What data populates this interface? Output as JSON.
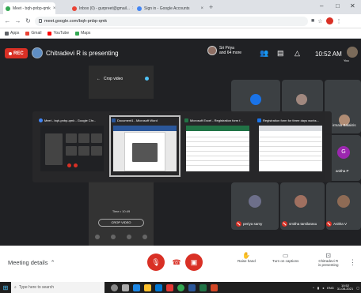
{
  "browser": {
    "tabs": [
      {
        "title": "Meet - bqh-pnbp-qmk",
        "favicon_color": "#34a853",
        "active": true
      },
      {
        "title": "Inbox (0) - gurpreet@gmail...",
        "favicon_color": "#ea4335",
        "active": false
      },
      {
        "title": "Sign in - Google Accounts",
        "favicon_color": "#4285f4",
        "active": false
      }
    ],
    "new_tab": "+",
    "window_controls": {
      "minimize": "–",
      "maximize": "□",
      "close": "✕"
    },
    "url": "meet.google.com/bqh-pnbp-qmk",
    "bookmarks": [
      {
        "label": "Apps",
        "color": "#5f6368"
      },
      {
        "label": "Gmail",
        "color": "#ea4335"
      },
      {
        "label": "YouTube",
        "color": "#ff0000"
      },
      {
        "label": "Maps",
        "color": "#34a853"
      }
    ]
  },
  "meet": {
    "rec_label": "REC",
    "presenter_status": "Chitradevi R is presenting",
    "participants_pill": {
      "line1": "Sri Priya",
      "line2": "and 64 more"
    },
    "clock": "10:52 AM",
    "you_label": "You",
    "phone_panel": {
      "menu_item": "Crop video",
      "time": "Time • 10:49",
      "crop_button": "CROP VIDEO"
    },
    "participants": [
      {
        "name": "periya samy",
        "avatar_color": "#6d6f8a"
      },
      {
        "name": "smitha tamilarasu",
        "avatar_color": "#a07060"
      },
      {
        "name": "Anitha V",
        "avatar_color": "#8e6b55"
      }
    ],
    "side_names": [
      {
        "name": "irmala Balakris",
        "avatar_color": "#b08c74"
      },
      {
        "name": "anitha P",
        "avatar_color": "#9c27b0",
        "initial": "G"
      }
    ]
  },
  "switcher": {
    "windows": [
      {
        "title": "Meet - bqh-pnbp-qmk - Google Chr...",
        "icon_color": "#4285f4",
        "selected": false
      },
      {
        "title": "Document1 - Microsoft Word",
        "icon_color": "#2b579a",
        "selected": true
      },
      {
        "title": "Microsoft Excel - Registration form f...",
        "icon_color": "#217346",
        "selected": false
      },
      {
        "title": "Registration form for three days works...",
        "icon_color": "#1a73e8",
        "selected": false
      }
    ]
  },
  "bottombar": {
    "meeting_details": "Meeting details",
    "chevron": "⌃",
    "raise_hand": "Raise hand",
    "captions": "Turn on captions",
    "presenting": {
      "line1": "Chitradevi R",
      "line2": "is presenting"
    },
    "more": "⋮"
  },
  "taskbar": {
    "search_placeholder": "Type here to search",
    "tray_lang": "ENG",
    "tray_time": "10:52",
    "tray_date": "31-08-2021"
  }
}
